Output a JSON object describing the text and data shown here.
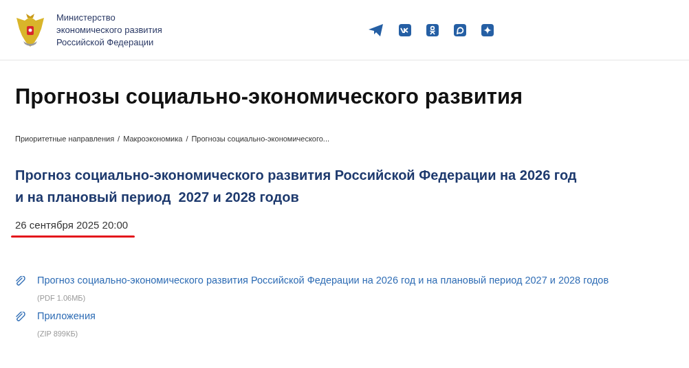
{
  "header": {
    "org_name_lines": [
      "Министерство",
      "экономического развития",
      "Российской Федерации"
    ],
    "social_links": [
      {
        "kind": "plane"
      },
      {
        "kind": "vk"
      },
      {
        "kind": "ok"
      },
      {
        "kind": "bubble"
      },
      {
        "kind": "star"
      }
    ]
  },
  "page_title": "Прогнозы социально-экономического развития",
  "breadcrumbs": [
    "Приоритетные направления",
    "Макроэкономика",
    "Прогнозы социально-экономического..."
  ],
  "breadcrumb_separator": "/",
  "article": {
    "title_lines": [
      "Прогноз социально-экономического развития Российской Федерации на 2026 год",
      "и на плановый период  2027 и 2028 годов"
    ],
    "date": "26 сентября 2025 20:00",
    "date_underlined": true
  },
  "attachments": [
    {
      "title": "Прогноз социально-экономического развития Российской Федерации на 2026 год и на плановый период 2027 и 2028 годов",
      "meta": "(PDF 1.06МБ)"
    },
    {
      "title": "Приложения",
      "meta": "(ZIP 899КБ)"
    }
  ]
}
